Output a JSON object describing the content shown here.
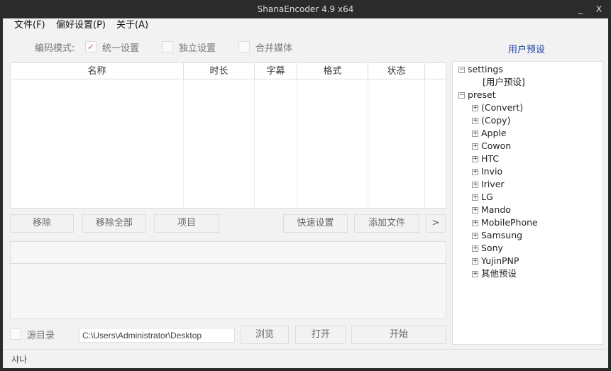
{
  "window": {
    "title": "ShanaEncoder 4.9 x64",
    "minimize": "_",
    "close": "X"
  },
  "menu": [
    "文件(F)",
    "偏好设置(P)",
    "关于(A)"
  ],
  "mode": {
    "label": "编码模式:",
    "options": [
      {
        "label": "统一设置",
        "checked": true
      },
      {
        "label": "独立设置",
        "checked": false
      },
      {
        "label": "合并媒体",
        "checked": false
      }
    ]
  },
  "list": {
    "columns": [
      "名称",
      "时长",
      "字幕",
      "格式",
      "状态"
    ]
  },
  "buttons": {
    "remove": "移除",
    "remove_all": "移除全部",
    "project": "项目",
    "quick": "快速设置",
    "add_file": "添加文件",
    "more": ">"
  },
  "output": {
    "source_dir_label": "源目录",
    "path": "C:\\Users\\Administrator\\Desktop",
    "browse": "浏览",
    "open": "打开",
    "start": "开始"
  },
  "status": "샤나",
  "presets": {
    "title": "用户预设",
    "settings": "settings",
    "user_preset": "[用户预设]",
    "preset": "preset",
    "items": [
      "(Convert)",
      "(Copy)",
      "Apple",
      "Cowon",
      "HTC",
      "Invio",
      "Iriver",
      "LG",
      "Mando",
      "MobilePhone",
      "Samsung",
      "Sony",
      "YujinPNP",
      "其他预设"
    ]
  },
  "colors": {
    "titlebar": "#2b2b2b",
    "accent": "#1a3fa0",
    "check": "#c060a0"
  }
}
